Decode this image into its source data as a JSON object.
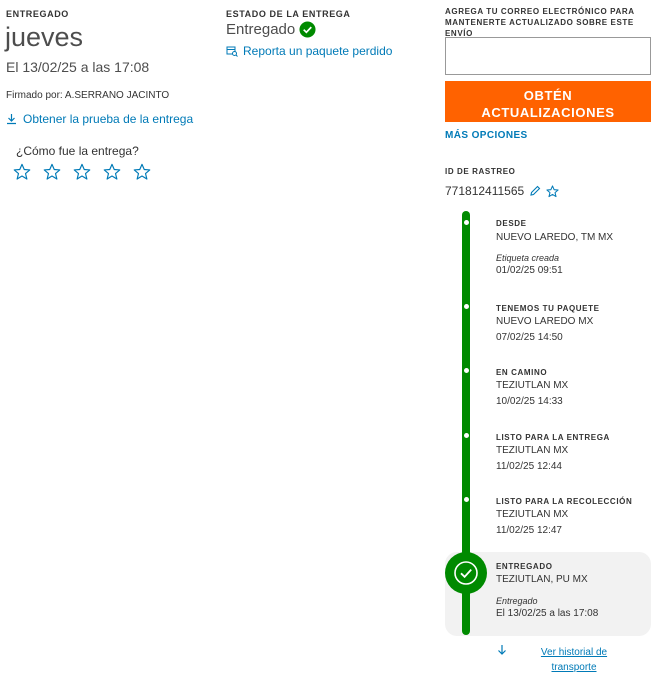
{
  "delivered_label": "ENTREGADO",
  "day": "jueves",
  "date": "El 13/02/25 a las 17:08",
  "signed_by": "Firmado por: A.SERRANO JACINTO",
  "proof_link": "Obtener la prueba de la entrega",
  "rating_question": "¿Cómo fue la entrega?",
  "rating": {
    "stars": 5,
    "selected": 0
  },
  "status": {
    "label": "ESTADO DE LA ENTREGA",
    "value": "Entregado",
    "lost_link": "Reporta un paquete perdido"
  },
  "email": {
    "label": "AGREGA TU CORREO ELECTRÓNICO PARA MANTENERTE ACTUALIZADO SOBRE ESTE ENVÍO",
    "placeholder": "",
    "button_line1": "OBTÉN",
    "button_line2": "ACTUALIZACIONES"
  },
  "more_options": "MÁS OPCIONES",
  "tracking": {
    "label": "ID DE RASTREO",
    "number": "771812411565"
  },
  "events": [
    {
      "title": "DESDE",
      "location": "NUEVO LAREDO, TM MX",
      "note": "Etiqueta creada",
      "time": "01/02/25 09:51"
    },
    {
      "title": "TENEMOS TU PAQUETE",
      "location": "NUEVO LAREDO MX",
      "note": "",
      "time": "07/02/25 14:50"
    },
    {
      "title": "EN CAMINO",
      "location": "TEZIUTLAN MX",
      "note": "",
      "time": "10/02/25 14:33"
    },
    {
      "title": "LISTO PARA LA ENTREGA",
      "location": "TEZIUTLAN MX",
      "note": "",
      "time": "11/02/25 12:44"
    },
    {
      "title": "LISTO PARA LA RECOLECCIÓN",
      "location": "TEZIUTLAN MX",
      "note": "",
      "time": "11/02/25 12:47"
    },
    {
      "title": "ENTREGADO",
      "location": "TEZIUTLAN, PU MX",
      "note": "Entregado",
      "time": "El 13/02/25 a las 17:08"
    }
  ],
  "history_line1": "Ver historial de",
  "history_line2": "transporte",
  "colors": {
    "accent_orange": "#ff6200",
    "success_green": "#008a00",
    "link_blue": "#007ab7"
  }
}
